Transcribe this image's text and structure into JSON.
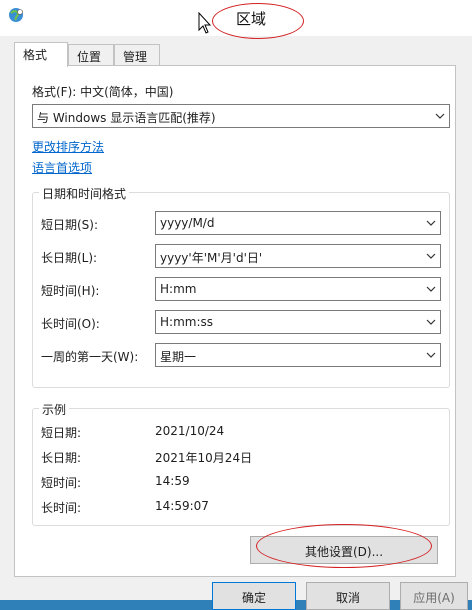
{
  "window": {
    "title": "区域"
  },
  "tabs": [
    {
      "label": "格式"
    },
    {
      "label": "位置"
    },
    {
      "label": "管理"
    }
  ],
  "format": {
    "label": "格式(F): 中文(简体，中国)",
    "selected": "与 Windows 显示语言匹配(推荐)"
  },
  "links": {
    "sort": "更改排序方法",
    "language": "语言首选项"
  },
  "datetime_group": {
    "title": "日期和时间格式",
    "rows": [
      {
        "label": "短日期(S):",
        "value": "yyyy/M/d"
      },
      {
        "label": "长日期(L):",
        "value": "yyyy'年'M'月'd'日'"
      },
      {
        "label": "短时间(H):",
        "value": "H:mm"
      },
      {
        "label": "长时间(O):",
        "value": "H:mm:ss"
      },
      {
        "label": "一周的第一天(W):",
        "value": "星期一"
      }
    ]
  },
  "example_group": {
    "title": "示例",
    "rows": [
      {
        "label": "短日期:",
        "value": "2021/10/24"
      },
      {
        "label": "长日期:",
        "value": "2021年10月24日"
      },
      {
        "label": "短时间:",
        "value": "14:59"
      },
      {
        "label": "长时间:",
        "value": "14:59:07"
      }
    ]
  },
  "buttons": {
    "other_settings": "其他设置(D)...",
    "ok": "确定",
    "cancel": "取消",
    "apply": "应用(A)"
  },
  "colors": {
    "link": "#0066cc",
    "annotation": "#d32020",
    "accent": "#0078d7"
  },
  "icons": [
    "region-globe-icon",
    "mouse-cursor-icon",
    "chevron-down-icon"
  ]
}
